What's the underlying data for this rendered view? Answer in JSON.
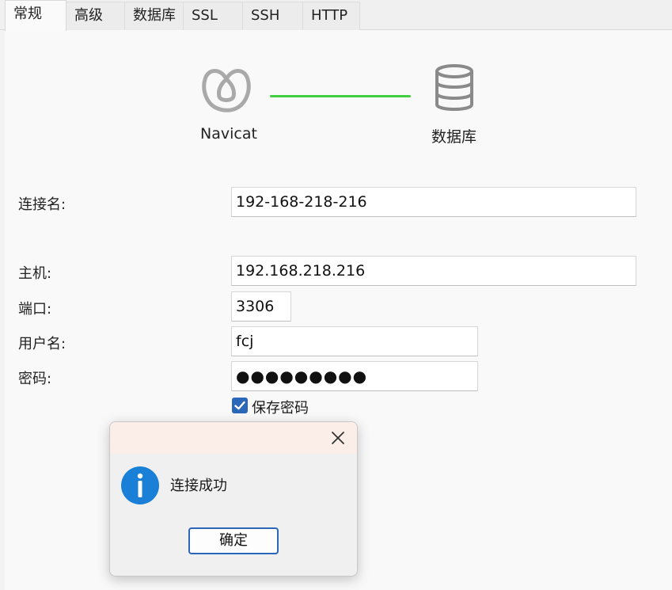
{
  "tabs": [
    {
      "label": "常规",
      "active": true
    },
    {
      "label": "高级",
      "active": false
    },
    {
      "label": "数据库",
      "active": false
    },
    {
      "label": "SSL",
      "active": false
    },
    {
      "label": "SSH",
      "active": false
    },
    {
      "label": "HTTP",
      "active": false
    }
  ],
  "illustration": {
    "left_label": "Navicat",
    "right_label": "数据库",
    "left_icon": "navicat-logo-icon",
    "right_icon": "database-icon",
    "line_color": "#3fcf3f"
  },
  "form": {
    "connection_name": {
      "label": "连接名:",
      "value": "192-168-218-216"
    },
    "host": {
      "label": "主机:",
      "value": "192.168.218.216"
    },
    "port": {
      "label": "端口:",
      "value": "3306"
    },
    "username": {
      "label": "用户名:",
      "value": "fcj"
    },
    "password": {
      "label": "密码:",
      "value": "●●●●●●●●●"
    },
    "save_password": {
      "label": "保存密码",
      "checked": true
    }
  },
  "dialog": {
    "message": "连接成功",
    "ok_label": "确定",
    "icon": "info-icon",
    "close_icon": "close-icon"
  },
  "colors": {
    "accent": "#2a67b8",
    "info_icon": "#1a7fd6",
    "success_line": "#3fcf3f",
    "dialog_titlebar": "#fbeee8"
  }
}
